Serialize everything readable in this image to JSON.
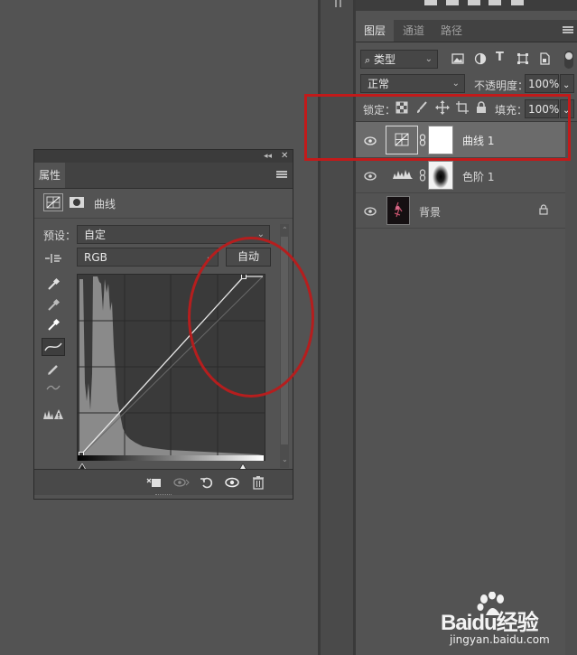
{
  "properties_panel": {
    "tab_label": "属性",
    "header_label": "曲线",
    "preset_label": "预设：",
    "preset_value": "自定",
    "channel_value": "RGB",
    "auto_button": "自动"
  },
  "layers_panel": {
    "tabs": [
      "图层",
      "通道",
      "路径"
    ],
    "filter_label": "类型",
    "blend_mode": "正常",
    "opacity_label": "不透明度：",
    "opacity_value": "100%",
    "lock_label": "锁定：",
    "fill_label": "填充：",
    "fill_value": "100%",
    "layers": [
      {
        "name": "曲线 1"
      },
      {
        "name": "色阶 1"
      },
      {
        "name": "背景"
      }
    ]
  },
  "watermark": {
    "brand": "Baidu经验",
    "url": "jingyan.baidu.com"
  },
  "colors": {
    "panel_bg": "#535353",
    "highlight_red": "#c21a1a"
  }
}
